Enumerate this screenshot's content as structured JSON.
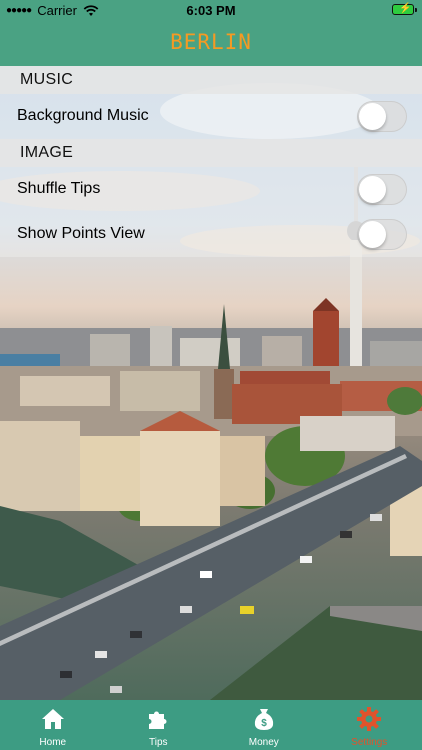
{
  "status_bar": {
    "carrier": "Carrier",
    "time": "6:03 PM"
  },
  "header": {
    "title": "BERLIN"
  },
  "sections": {
    "music": {
      "title": "MUSIC",
      "items": [
        {
          "label": "Background Music",
          "enabled": false
        }
      ]
    },
    "image": {
      "title": "IMAGE",
      "items": [
        {
          "label": "Shuffle Tips",
          "enabled": false
        },
        {
          "label": "Show Points View",
          "enabled": false
        }
      ]
    }
  },
  "tabs": [
    {
      "label": "Home",
      "icon": "home-icon"
    },
    {
      "label": "Tips",
      "icon": "puzzle-icon"
    },
    {
      "label": "Money",
      "icon": "money-bag-icon"
    },
    {
      "label": "Settings",
      "icon": "gear-icon",
      "active": true
    }
  ],
  "colors": {
    "header_bg": "#4aa283",
    "title": "#f59a23",
    "tab_bg": "#3d9c83",
    "active_tab": "#e0532c"
  }
}
